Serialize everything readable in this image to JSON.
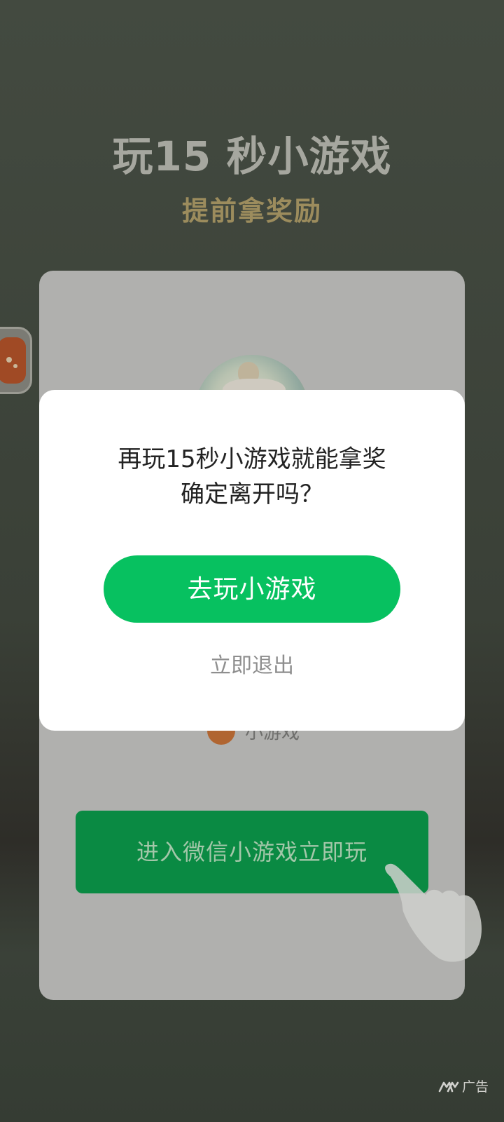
{
  "background": {
    "title": "玩15 秒小游戏",
    "subtitle": "提前拿奖励",
    "card": {
      "small_game_label": "小游戏",
      "enter_button_label": "进入微信小游戏立即玩"
    }
  },
  "dialog": {
    "message_line1": "再玩15秒小游戏就能拿奖",
    "message_line2": "确定离开吗？",
    "play_button_label": "去玩小游戏",
    "exit_label": "立即退出"
  },
  "ad_badge": {
    "label": "广告",
    "icon": "ad-logo-icon"
  },
  "colors": {
    "primary_green": "#07c160",
    "dim_green": "#0a8a43",
    "subtitle_gold": "#9c8c5d"
  }
}
